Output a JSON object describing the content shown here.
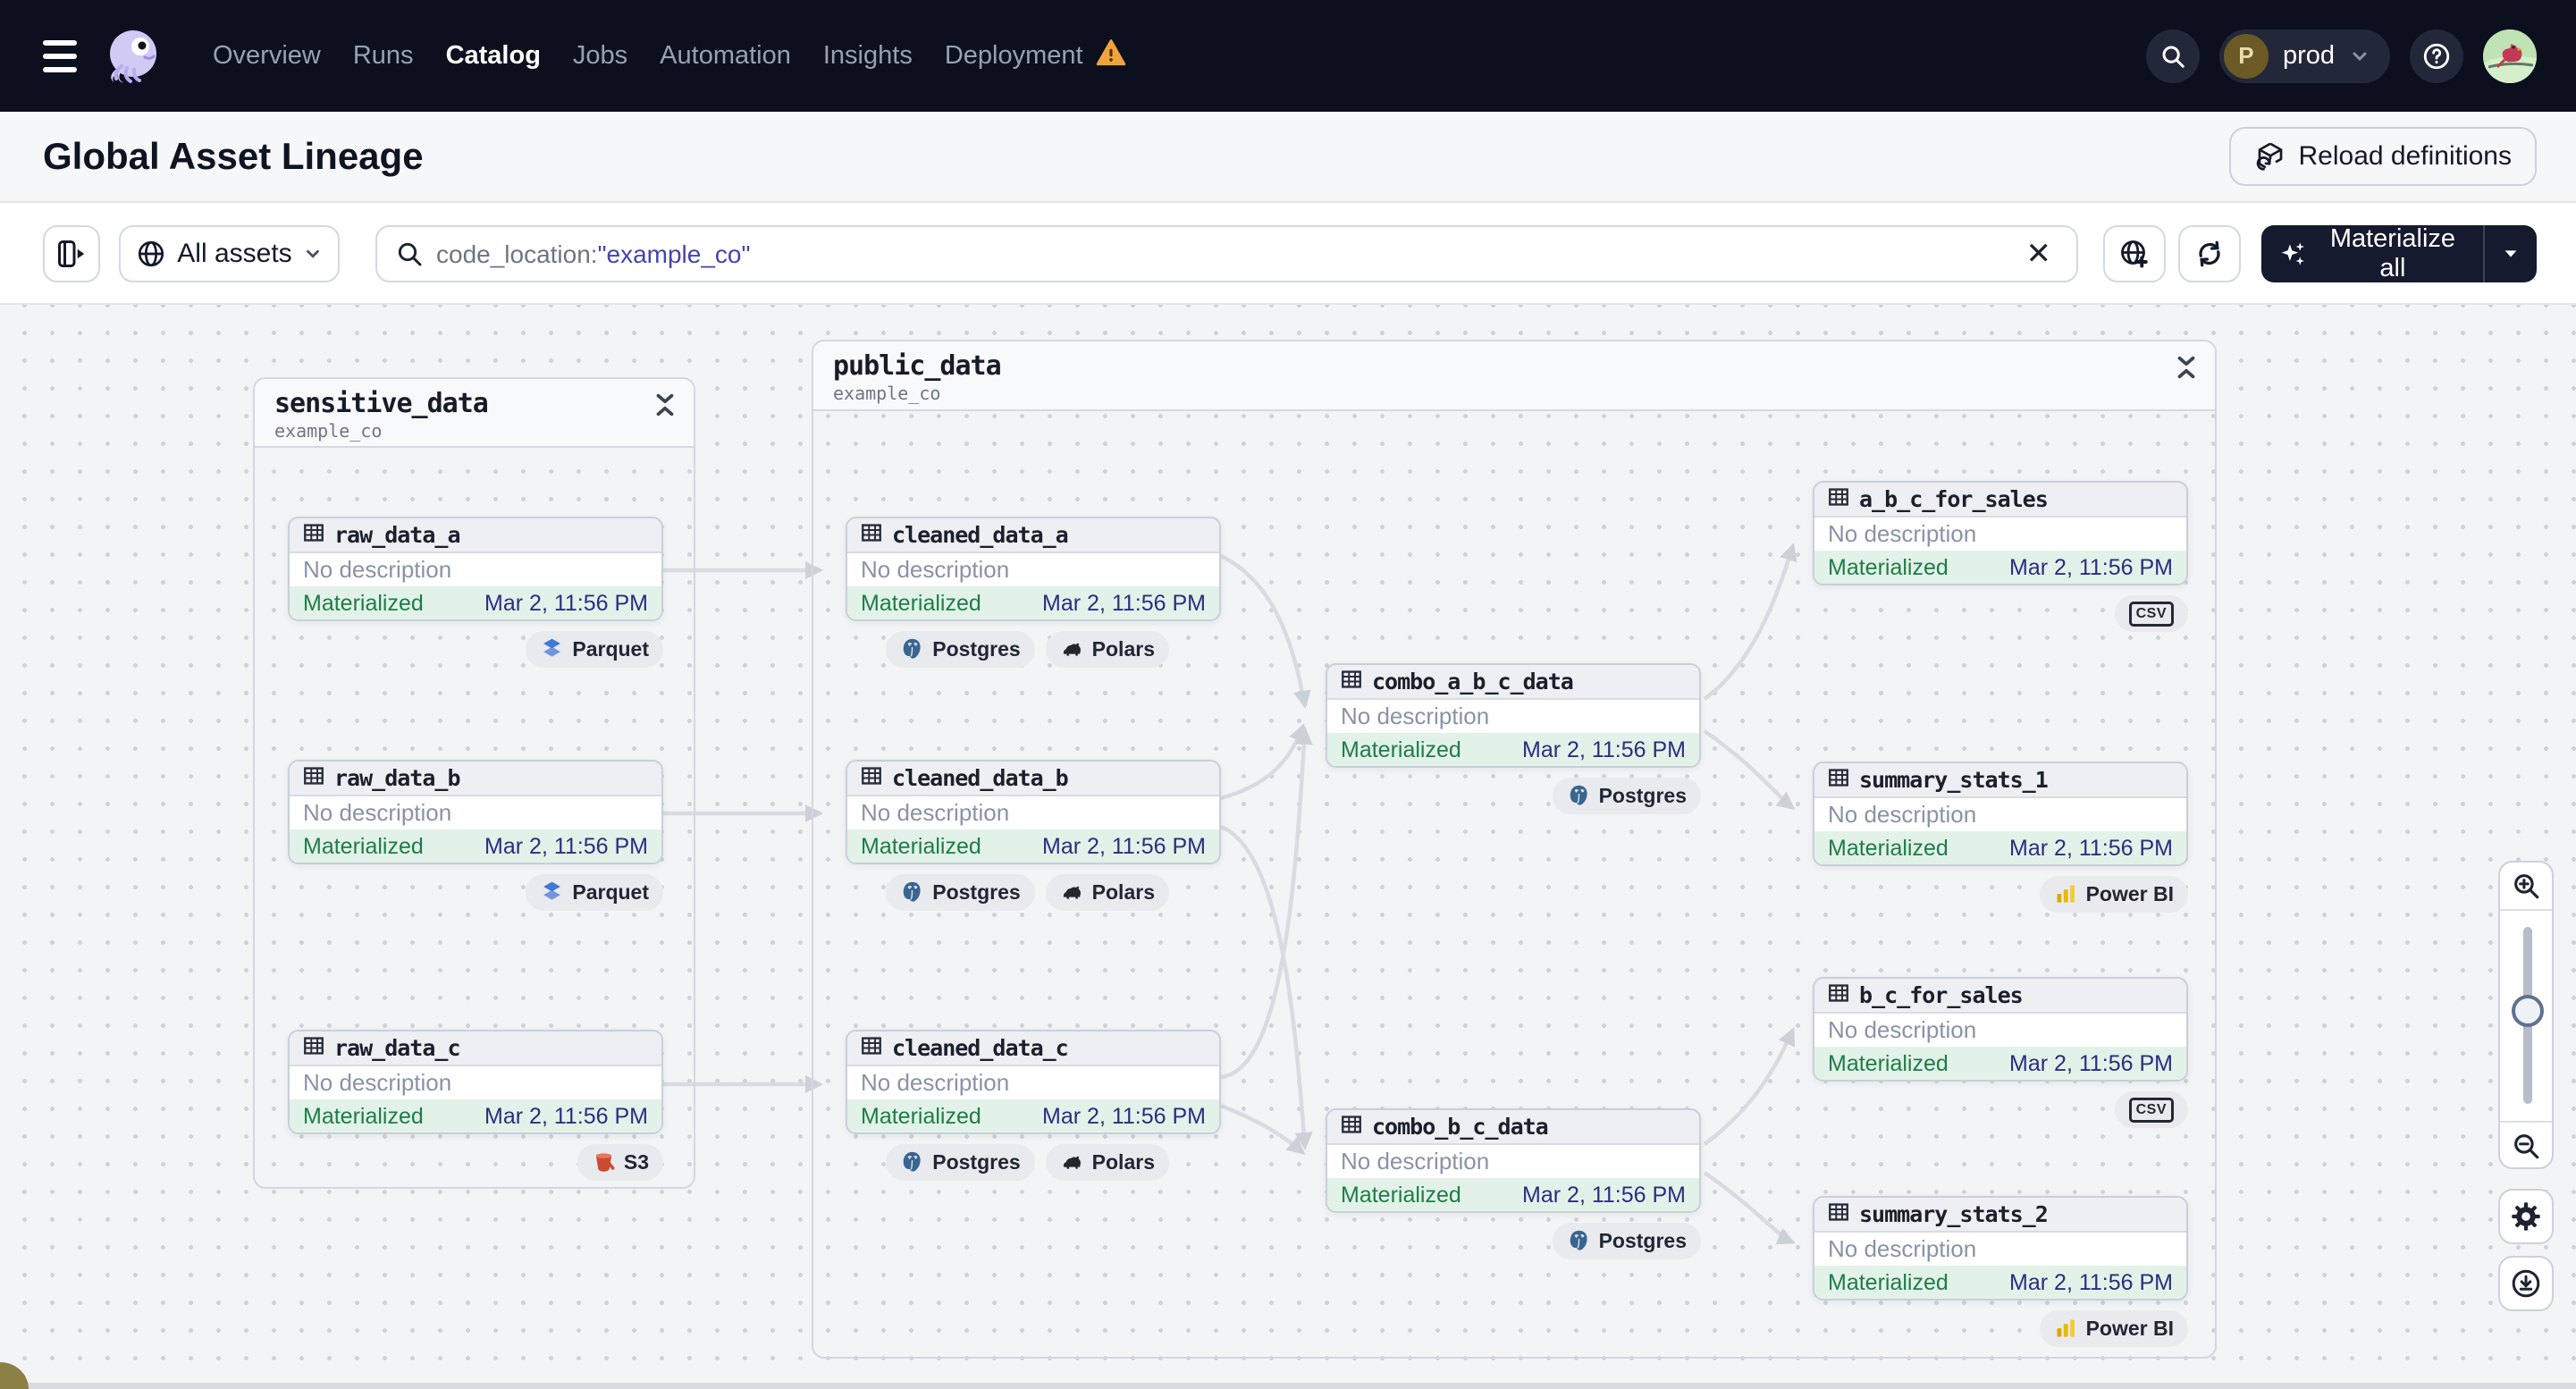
{
  "nav": {
    "items": [
      {
        "label": "Overview",
        "active": false,
        "warning": false
      },
      {
        "label": "Runs",
        "active": false,
        "warning": false
      },
      {
        "label": "Catalog",
        "active": true,
        "warning": false
      },
      {
        "label": "Jobs",
        "active": false,
        "warning": false
      },
      {
        "label": "Automation",
        "active": false,
        "warning": false
      },
      {
        "label": "Insights",
        "active": false,
        "warning": false
      },
      {
        "label": "Deployment",
        "active": false,
        "warning": true
      }
    ],
    "environment": {
      "initial": "P",
      "label": "prod"
    }
  },
  "page": {
    "title": "Global Asset Lineage",
    "reload_button_label": "Reload definitions"
  },
  "filterbar": {
    "scope_button_label": "All assets",
    "search_prefix": "code_location:",
    "search_value": "\"example_co\"",
    "clear_label": "✕",
    "materialize_button_label": "Materialize all"
  },
  "graph": {
    "groups": [
      {
        "name": "sensitive_data",
        "location": "example_co",
        "nodes": [
          {
            "name": "raw_data_a",
            "description": "No description",
            "status": "Materialized",
            "timestamp": "Mar 2, 11:56 PM",
            "badges": [
              {
                "icon": "parquet-icon",
                "label": "Parquet"
              }
            ]
          },
          {
            "name": "raw_data_b",
            "description": "No description",
            "status": "Materialized",
            "timestamp": "Mar 2, 11:56 PM",
            "badges": [
              {
                "icon": "parquet-icon",
                "label": "Parquet"
              }
            ]
          },
          {
            "name": "raw_data_c",
            "description": "No description",
            "status": "Materialized",
            "timestamp": "Mar 2, 11:56 PM",
            "badges": [
              {
                "icon": "s3-icon",
                "label": "S3"
              }
            ]
          }
        ]
      },
      {
        "name": "public_data",
        "location": "example_co",
        "nodes": [
          {
            "name": "cleaned_data_a",
            "description": "No description",
            "status": "Materialized",
            "timestamp": "Mar 2, 11:56 PM",
            "badges": [
              {
                "icon": "postgres-icon",
                "label": "Postgres"
              },
              {
                "icon": "polars-icon",
                "label": "Polars"
              }
            ]
          },
          {
            "name": "cleaned_data_b",
            "description": "No description",
            "status": "Materialized",
            "timestamp": "Mar 2, 11:56 PM",
            "badges": [
              {
                "icon": "postgres-icon",
                "label": "Postgres"
              },
              {
                "icon": "polars-icon",
                "label": "Polars"
              }
            ]
          },
          {
            "name": "cleaned_data_c",
            "description": "No description",
            "status": "Materialized",
            "timestamp": "Mar 2, 11:56 PM",
            "badges": [
              {
                "icon": "postgres-icon",
                "label": "Postgres"
              },
              {
                "icon": "polars-icon",
                "label": "Polars"
              }
            ]
          },
          {
            "name": "combo_a_b_c_data",
            "description": "No description",
            "status": "Materialized",
            "timestamp": "Mar 2, 11:56 PM",
            "badges": [
              {
                "icon": "postgres-icon",
                "label": "Postgres"
              }
            ]
          },
          {
            "name": "combo_b_c_data",
            "description": "No description",
            "status": "Materialized",
            "timestamp": "Mar 2, 11:56 PM",
            "badges": [
              {
                "icon": "postgres-icon",
                "label": "Postgres"
              }
            ]
          },
          {
            "name": "a_b_c_for_sales",
            "description": "No description",
            "status": "Materialized",
            "timestamp": "Mar 2, 11:56 PM",
            "badges": [
              {
                "icon": "csv-icon",
                "label": "csv"
              }
            ]
          },
          {
            "name": "summary_stats_1",
            "description": "No description",
            "status": "Materialized",
            "timestamp": "Mar 2, 11:56 PM",
            "badges": [
              {
                "icon": "powerbi-icon",
                "label": "Power BI"
              }
            ]
          },
          {
            "name": "b_c_for_sales",
            "description": "No description",
            "status": "Materialized",
            "timestamp": "Mar 2, 11:56 PM",
            "badges": [
              {
                "icon": "csv-icon",
                "label": "csv"
              }
            ]
          },
          {
            "name": "summary_stats_2",
            "description": "No description",
            "status": "Materialized",
            "timestamp": "Mar 2, 11:56 PM",
            "badges": [
              {
                "icon": "powerbi-icon",
                "label": "Power BI"
              }
            ]
          }
        ]
      }
    ]
  },
  "colors": {
    "nav_bg": "#0b0f1e",
    "status_green": "#1e7c49",
    "status_row_bg": "#e2f2e8",
    "timestamp_blue": "#2d2d80",
    "warning_orange": "#f0a23c",
    "search_value_blue": "#4444ad",
    "materialize_bg": "#161a2e",
    "edge_gray": "#d9dbe1"
  }
}
